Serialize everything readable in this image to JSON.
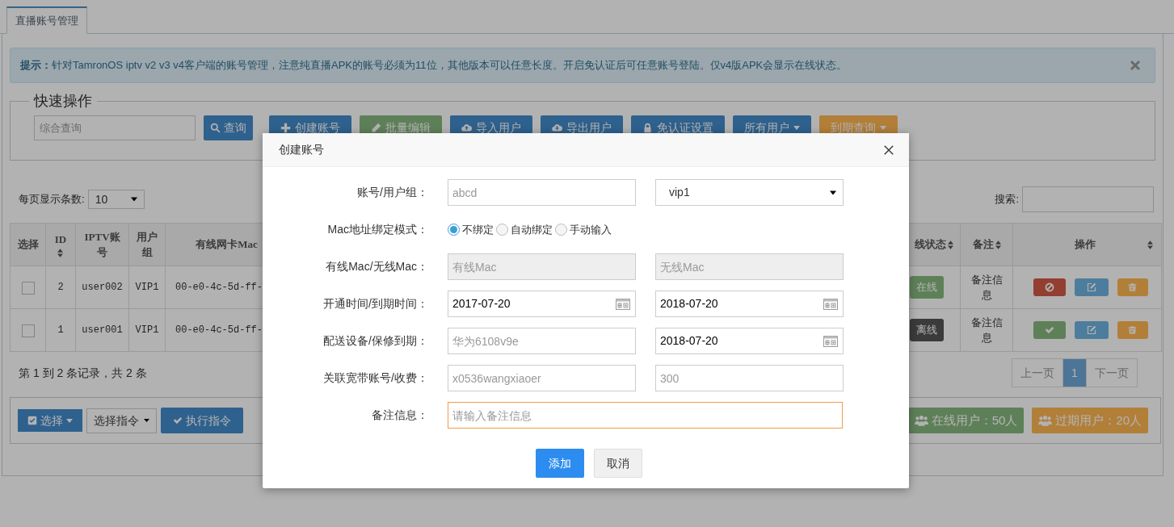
{
  "tabs": [
    {
      "label": "直播账号管理",
      "selected": true
    }
  ],
  "alert": {
    "text": "**提示：**针对TamronOS iptv v2 v3 v4客户端的账号管理，注意纯直播APK的账号必须为11位，其他版本可以任意长度。开启免认证后可任意账号登陆。仅v4版APK会显示在线状态。"
  },
  "quick_actions": {
    "legend": "快速操作",
    "search": {
      "placeholder": "综合查询"
    },
    "search_button": "查询",
    "buttons": [
      {
        "label": "创建账号",
        "kind": "primary",
        "dropdown": false
      },
      {
        "label": "批量编辑",
        "kind": "success",
        "dropdown": false
      },
      {
        "label": "导入用户",
        "kind": "primary",
        "dropdown": false
      },
      {
        "label": "导出用户",
        "kind": "primary",
        "dropdown": false
      },
      {
        "label": "免认证设置",
        "kind": "primary",
        "dropdown": false
      },
      {
        "label": "所有用户",
        "kind": "primary",
        "dropdown": true
      },
      {
        "label": "到期查询",
        "kind": "warning",
        "dropdown": true
      }
    ]
  },
  "page_size": {
    "label": "每页显示条数:",
    "value": "10"
  },
  "search": {
    "label": "搜索:"
  },
  "table": {
    "columns": [
      {
        "label": "选择",
        "sortable": false
      },
      {
        "label": "ID",
        "sortable": true
      },
      {
        "label": "IPTV账号",
        "sortable": false
      },
      {
        "label": "用户组",
        "sortable": false
      },
      {
        "label": "有线网卡Mac",
        "sortable": false
      },
      {
        "label": "线状态",
        "sortable": true
      },
      {
        "label": "备注",
        "sortable": true
      },
      {
        "label": "操作",
        "sortable": true
      }
    ],
    "rows": [
      {
        "checked": false,
        "id": "2",
        "account": "user002",
        "group": "VIP1",
        "mac": "00-e0-4c-5d-ff-",
        "status": "在线",
        "online": true,
        "note": "备注信息",
        "enabled": true
      },
      {
        "checked": false,
        "id": "1",
        "account": "user001",
        "group": "VIP1",
        "mac": "00-e0-4c-5d-ff-",
        "status": "离线",
        "online": false,
        "note": "备注信息",
        "enabled": false
      }
    ]
  },
  "summary": "第 1 到 2 条记录，共 2 条",
  "pagination": [
    {
      "label": "上一页",
      "selected": false
    },
    {
      "label": "1",
      "selected": true
    },
    {
      "label": "下一页",
      "selected": false
    }
  ],
  "bottom_bar": {
    "select_button": "选择",
    "command": {
      "value": "选择指令"
    },
    "execute_button": "执行指令",
    "stats": [
      {
        "label": "在线用户：50人",
        "kind": "success"
      },
      {
        "label": "过期用户：20人",
        "kind": "warning"
      }
    ]
  },
  "dialog": {
    "title": "创建账号",
    "rows": [
      {
        "label": "账号/用户组：",
        "controls": [
          {
            "kind": "input",
            "placeholder": "abcd",
            "disabled": false,
            "focused": false
          },
          {
            "kind": "select",
            "value": "vip1"
          }
        ]
      },
      {
        "label": "Mac地址绑定模式：",
        "controls": [
          {
            "kind": "radio",
            "options": [
              {
                "label": "不绑定",
                "selected": true
              },
              {
                "label": "自动绑定",
                "selected": false
              },
              {
                "label": "手动输入",
                "selected": false
              }
            ]
          }
        ]
      },
      {
        "label": "有线Mac/无线Mac：",
        "controls": [
          {
            "kind": "input",
            "placeholder": "有线Mac",
            "disabled": true,
            "focused": false
          },
          {
            "kind": "input",
            "placeholder": "无线Mac",
            "disabled": true,
            "focused": false
          }
        ]
      },
      {
        "label": "开通时间/到期时间：",
        "controls": [
          {
            "kind": "date",
            "value": "2017-07-20"
          },
          {
            "kind": "date",
            "value": "2018-07-20"
          }
        ]
      },
      {
        "label": "配送设备/保修到期：",
        "controls": [
          {
            "kind": "input",
            "placeholder": "华为6108v9e",
            "disabled": false,
            "focused": false
          },
          {
            "kind": "date",
            "value": "2018-07-20"
          }
        ]
      },
      {
        "label": "关联宽带账号/收费：",
        "controls": [
          {
            "kind": "input",
            "placeholder": "x0536wangxiaoer",
            "disabled": false,
            "focused": false
          },
          {
            "kind": "input",
            "placeholder": "300",
            "disabled": false,
            "focused": false
          }
        ]
      },
      {
        "label": "备注信息：",
        "controls": [
          {
            "kind": "input",
            "placeholder": "请输入备注信息",
            "disabled": false,
            "focused": true
          }
        ]
      }
    ],
    "buttons": [
      {
        "label": "添加",
        "kind": "primary"
      },
      {
        "label": "取消",
        "kind": "default"
      }
    ]
  }
}
